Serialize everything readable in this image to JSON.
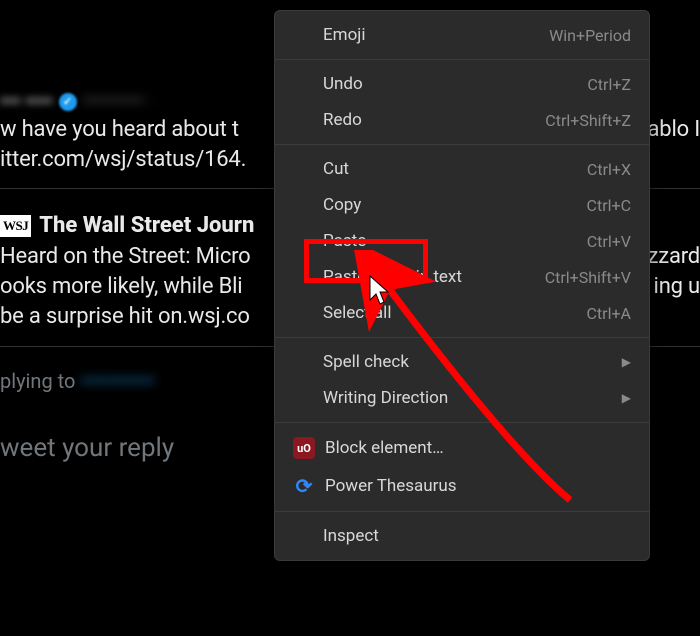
{
  "background": {
    "author1": {
      "name": "••• ••••",
      "handle": "•••••••••• ·"
    },
    "tweet1_line1": "w have you heard about t",
    "tweet1_line1_right": "ablo I",
    "tweet1_line2": "itter.com/wsj/status/164.",
    "wsj_badge": "WSJ",
    "wsj_name": "The Wall Street Journ",
    "tweet2_line1": "Heard on the Street: Micro",
    "tweet2_line1_right": "zzard",
    "tweet2_line2": "ooks more likely, while Bli",
    "tweet2_line2_right": "ing u",
    "tweet2_line3": "be a surprise hit on.wsj.co",
    "replying_to": "plying to",
    "replying_handle": "•••••••••••",
    "reply_placeholder": "weet your reply"
  },
  "menu": {
    "emoji": {
      "label": "Emoji",
      "shortcut": "Win+Period"
    },
    "undo": {
      "label": "Undo",
      "shortcut": "Ctrl+Z"
    },
    "redo": {
      "label": "Redo",
      "shortcut": "Ctrl+Shift+Z"
    },
    "cut": {
      "label": "Cut",
      "shortcut": "Ctrl+X"
    },
    "copy": {
      "label": "Copy",
      "shortcut": "Ctrl+C"
    },
    "paste": {
      "label": "Paste",
      "shortcut": "Ctrl+V"
    },
    "paste_plain": {
      "label": "Paste as plain text",
      "shortcut": "Ctrl+Shift+V"
    },
    "select_all": {
      "label": "Select all",
      "shortcut": "Ctrl+A"
    },
    "spell_check": {
      "label": "Spell check"
    },
    "writing_direction": {
      "label": "Writing Direction"
    },
    "block_element": {
      "label": "Block element…"
    },
    "power_thesaurus": {
      "label": "Power Thesaurus"
    },
    "inspect": {
      "label": "Inspect"
    }
  },
  "annotation": {
    "highlighted_item": "paste"
  }
}
